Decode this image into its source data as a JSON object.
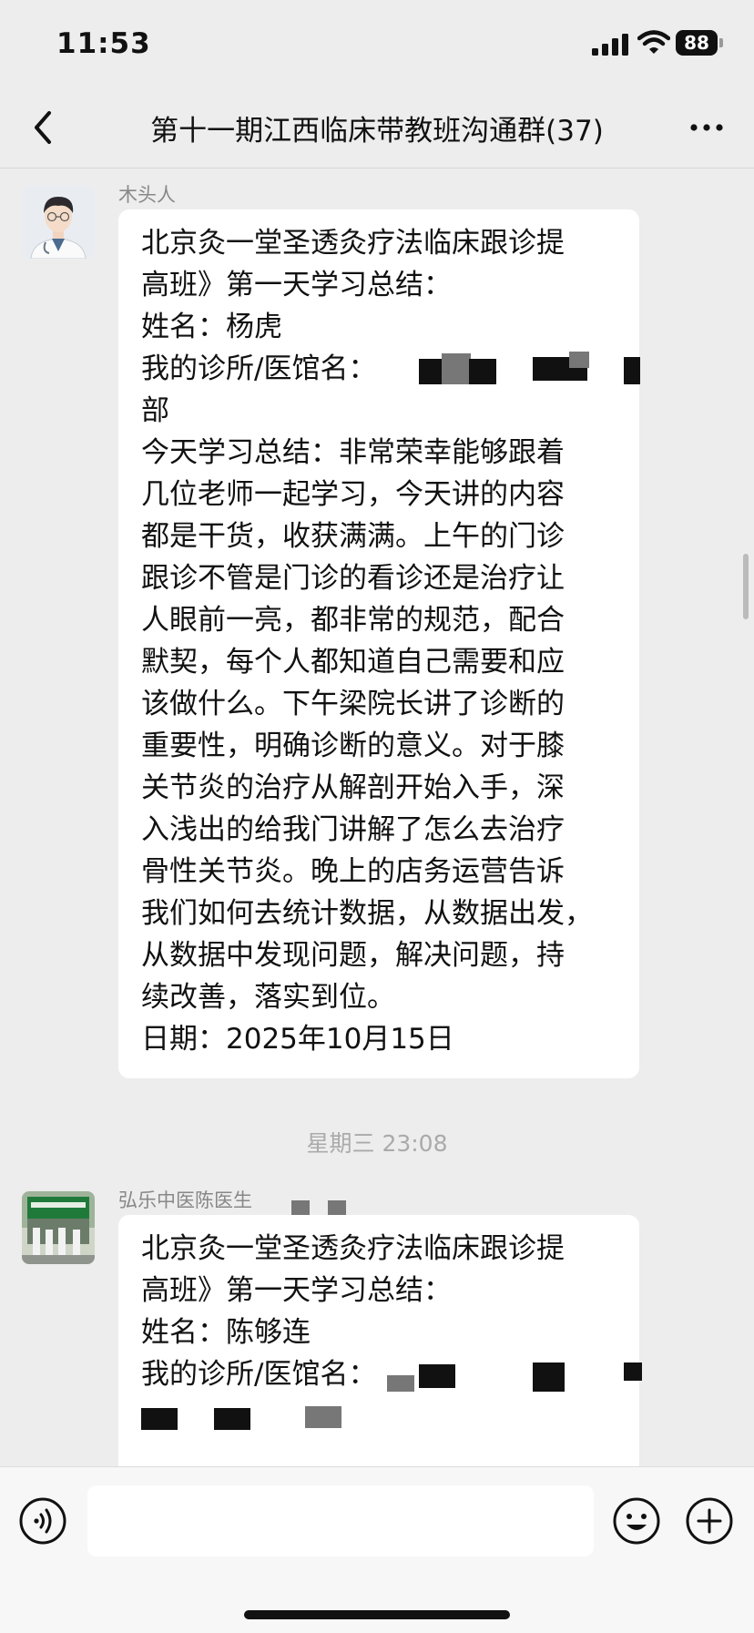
{
  "status_bar": {
    "time": "11:53",
    "battery": "88"
  },
  "header": {
    "title": "第十一期江西临床带教班沟通群(37)"
  },
  "messages": [
    {
      "sender": "木头人",
      "lines": [
        "北京灸一堂圣透灸疗法临床跟诊提",
        "高班》第一天学习总结：",
        "姓名：杨虎",
        "我的诊所/医馆名：",
        "部",
        "今天学习总结：非常荣幸能够跟着",
        "几位老师一起学习，今天讲的内容",
        "都是干货，收获满满。上午的门诊",
        "跟诊不管是门诊的看诊还是治疗让",
        "人眼前一亮，都非常的规范，配合",
        "默契，每个人都知道自己需要和应",
        "该做什么。下午梁院长讲了诊断的",
        "重要性，明确诊断的意义。对于膝",
        "关节炎的治疗从解剖开始入手，深",
        "入浅出的给我门讲解了怎么去治疗",
        "骨性关节炎。晚上的店务运营告诉",
        "我们如何去统计数据，从数据出发，",
        "从数据中发现问题，解决问题，持",
        "续改善，落实到位。",
        "日期：2025年10月15日"
      ]
    },
    {
      "timestamp": "星期三 23:08"
    },
    {
      "sender": "弘乐中医陈医生",
      "lines": [
        "北京灸一堂圣透灸疗法临床跟诊提",
        "高班》第一天学习总结：",
        "姓名：陈够连",
        "我的诊所/医馆名："
      ]
    }
  ],
  "icons": {
    "back": "chevron-left-icon",
    "more": "more-dots-icon",
    "voice": "voice-icon",
    "emoji": "emoji-icon",
    "plus": "plus-icon"
  }
}
